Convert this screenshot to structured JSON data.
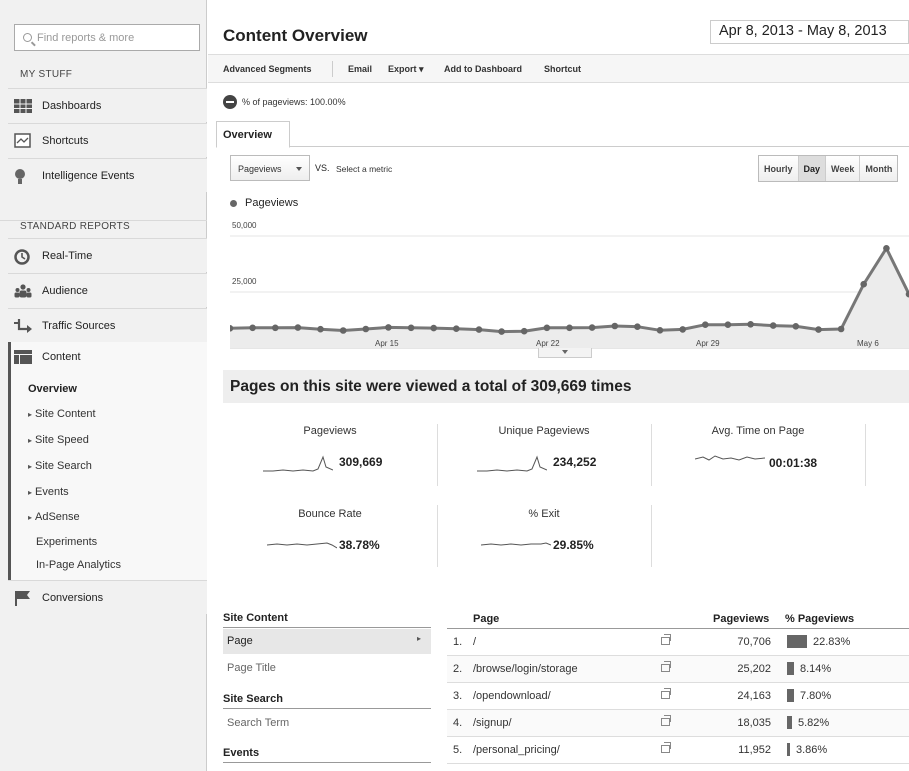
{
  "sidebar": {
    "search_placeholder": "Find reports & more",
    "my_stuff_heading": "MY STUFF",
    "my_stuff_items": [
      {
        "label": "Dashboards",
        "icon": "dashboard-icon"
      },
      {
        "label": "Shortcuts",
        "icon": "shortcuts-icon"
      },
      {
        "label": "Intelligence Events",
        "icon": "lightbulb-icon"
      }
    ],
    "standard_reports_heading": "STANDARD REPORTS",
    "report_items": [
      {
        "label": "Real-Time",
        "icon": "realtime-icon"
      },
      {
        "label": "Audience",
        "icon": "audience-icon"
      },
      {
        "label": "Traffic Sources",
        "icon": "traffic-icon"
      },
      {
        "label": "Content",
        "icon": "content-icon"
      }
    ],
    "content_subitems": [
      "Overview",
      "Site Content",
      "Site Speed",
      "Site Search",
      "Events",
      "AdSense",
      "Experiments",
      "In-Page Analytics"
    ],
    "conversions_label": "Conversions"
  },
  "header": {
    "title": "Content Overview",
    "date_range": "Apr 8, 2013 - May 8, 2013"
  },
  "toolbar": {
    "advanced_segments": "Advanced Segments",
    "email": "Email",
    "export": "Export",
    "add_to_dashboard": "Add to Dashboard",
    "shortcut": "Shortcut"
  },
  "segment": {
    "text": "% of pageviews: 100.00%"
  },
  "tabs": {
    "overview": "Overview"
  },
  "chart_controls": {
    "metric": "Pageviews",
    "vs": "VS.",
    "select_metric": "Select a metric",
    "granularity": [
      "Hourly",
      "Day",
      "Week",
      "Month"
    ],
    "selected_granularity": "Day"
  },
  "chart_data": {
    "type": "line",
    "legend": [
      "Pageviews"
    ],
    "series": [
      {
        "name": "Pageviews",
        "values": [
          8800,
          9000,
          9000,
          9100,
          8400,
          7800,
          8500,
          9200,
          9000,
          8900,
          8600,
          8200,
          7300,
          7500,
          9000,
          9000,
          9100,
          9800,
          9500,
          7900,
          8300,
          10400,
          10400,
          10600,
          10000,
          9700,
          8200,
          8500,
          28500,
          44500,
          24000
        ]
      }
    ],
    "x_ticks": [
      "Apr 15",
      "Apr 22",
      "Apr 29",
      "May 6"
    ],
    "y_ticks": [
      "50,000",
      "25,000"
    ],
    "ylim": [
      0,
      50000
    ],
    "colors": {
      "line": "#777777",
      "fill": "#ececec"
    }
  },
  "summary": {
    "headline": "Pages on this site were viewed a total of 309,669 times",
    "metrics": [
      {
        "label": "Pageviews",
        "value": "309,669"
      },
      {
        "label": "Unique Pageviews",
        "value": "234,252"
      },
      {
        "label": "Avg. Time on Page",
        "value": "00:01:38"
      },
      {
        "label": "Bounce Rate",
        "value": "38.78%"
      },
      {
        "label": "% Exit",
        "value": "29.85%"
      }
    ]
  },
  "left_table": {
    "site_content_heading": "Site Content",
    "page": "Page",
    "page_title": "Page Title",
    "site_search_heading": "Site Search",
    "search_term": "Search Term",
    "events_heading": "Events"
  },
  "right_table": {
    "col_page": "Page",
    "col_pageviews": "Pageviews",
    "col_pct": "% Pageviews",
    "rows": [
      {
        "idx": "1.",
        "page": "/",
        "pageviews": "70,706",
        "pct": "22.83%",
        "pct_value": 22.83
      },
      {
        "idx": "2.",
        "page": "/browse/login/storage",
        "pageviews": "25,202",
        "pct": "8.14%",
        "pct_value": 8.14
      },
      {
        "idx": "3.",
        "page": "/opendownload/",
        "pageviews": "24,163",
        "pct": "7.80%",
        "pct_value": 7.8
      },
      {
        "idx": "4.",
        "page": "/signup/",
        "pageviews": "18,035",
        "pct": "5.82%",
        "pct_value": 5.82
      },
      {
        "idx": "5.",
        "page": "/personal_pricing/",
        "pageviews": "11,952",
        "pct": "3.86%",
        "pct_value": 3.86
      }
    ]
  }
}
